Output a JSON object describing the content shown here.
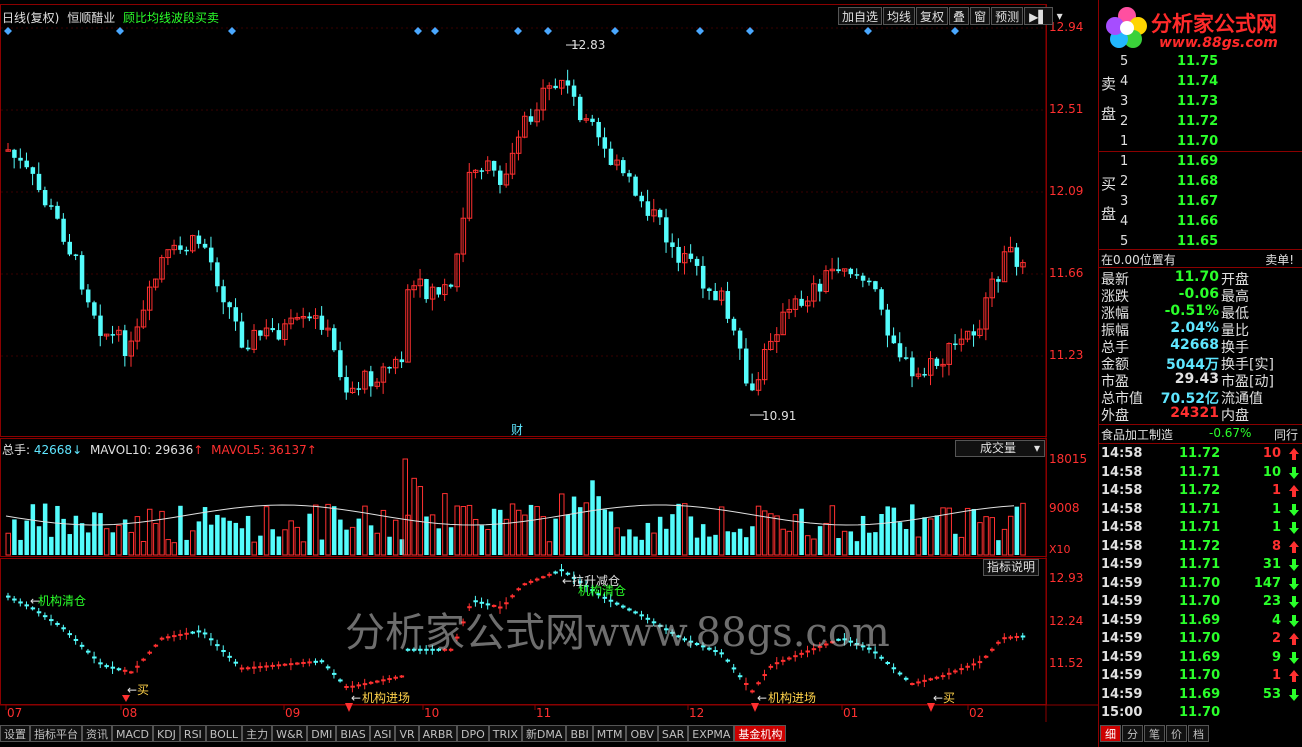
{
  "header": {
    "chart_title": "日线(复权)",
    "stock_name": "恒顺醋业",
    "indicator_name": "顾比均线波段买卖"
  },
  "toolbar": {
    "add_watch": "加自选",
    "ma": "均线",
    "restore": "复权",
    "overlay": "叠",
    "window": "窗",
    "forecast": "预测"
  },
  "price_axis": [
    "12.94",
    "12.51",
    "12.09",
    "11.66",
    "11.23"
  ],
  "price_labels": {
    "high": "12.83",
    "low": "10.91",
    "event": "财"
  },
  "volume_pane": {
    "label_total": "总手:",
    "total_value": "42668",
    "label_ma10": "MAVOL10:",
    "ma10_value": "29636",
    "label_ma5": "MAVOL5:",
    "ma5_value": "36137",
    "name": "成交量",
    "axis": [
      "18015",
      "9008"
    ],
    "unit": "X10"
  },
  "indicator_pane": {
    "help_button": "指标说明",
    "axis": [
      "12.93",
      "12.24",
      "11.52"
    ],
    "labels": {
      "clear1": "机构清仓",
      "buy1": "买",
      "enter1": "机构进场",
      "pull": "拉升减仓",
      "clear2": "机构清仓",
      "enter2": "机构进场",
      "buy2": "买"
    }
  },
  "date_axis": [
    "07",
    "08",
    "09",
    "10",
    "11",
    "12",
    "01",
    "02"
  ],
  "watermark": "分析家公式网www.88gs.com",
  "logo": {
    "name": "分析家公式网",
    "url": "www.88gs.com"
  },
  "orderbook": {
    "sell_label": [
      "卖",
      "盘"
    ],
    "buy_label": [
      "买",
      "盘"
    ],
    "sells": [
      {
        "level": "5",
        "price": "11.75"
      },
      {
        "level": "4",
        "price": "11.74"
      },
      {
        "level": "3",
        "price": "11.73"
      },
      {
        "level": "2",
        "price": "11.72"
      },
      {
        "level": "1",
        "price": "11.70"
      }
    ],
    "buys": [
      {
        "level": "1",
        "price": "11.69"
      },
      {
        "level": "2",
        "price": "11.68"
      },
      {
        "level": "3",
        "price": "11.67"
      },
      {
        "level": "4",
        "price": "11.66"
      },
      {
        "level": "5",
        "price": "11.65"
      }
    ]
  },
  "position": {
    "left": "在0.00位置有",
    "right": "卖单!"
  },
  "stats": [
    {
      "k1": "最新",
      "v1": "11.70",
      "c": "#2aff2a",
      "k2": "开盘"
    },
    {
      "k1": "涨跌",
      "v1": "-0.06",
      "c": "#2aff2a",
      "k2": "最高"
    },
    {
      "k1": "涨幅",
      "v1": "-0.51%",
      "c": "#2aff2a",
      "k2": "最低"
    },
    {
      "k1": "振幅",
      "v1": "2.04%",
      "c": "#5fe6ff",
      "k2": "量比"
    },
    {
      "k1": "总手",
      "v1": "42668",
      "c": "#5fe6ff",
      "k2": "换手"
    },
    {
      "k1": "金额",
      "v1": "5044万",
      "c": "#5fe6ff",
      "k2": "换手[实]"
    },
    {
      "k1": "市盈",
      "v1": "29.43",
      "c": "#e0e0e0",
      "k2": "市盈[动]"
    },
    {
      "k1": "总市值",
      "v1": "70.52亿",
      "c": "#5fe6ff",
      "k2": "流通值"
    },
    {
      "k1": "外盘",
      "v1": "24321",
      "c": "#ff3030",
      "k2": "内盘"
    }
  ],
  "sector": {
    "name": "食品加工制造",
    "change": "-0.67%",
    "peer": "同行"
  },
  "ticks": [
    {
      "t": "14:58",
      "p": "11.72",
      "v": "10",
      "dir": "up"
    },
    {
      "t": "14:58",
      "p": "11.71",
      "v": "10",
      "dir": "down"
    },
    {
      "t": "14:58",
      "p": "11.72",
      "v": "1",
      "dir": "up"
    },
    {
      "t": "14:58",
      "p": "11.71",
      "v": "1",
      "dir": "down"
    },
    {
      "t": "14:58",
      "p": "11.71",
      "v": "1",
      "dir": "down"
    },
    {
      "t": "14:58",
      "p": "11.72",
      "v": "8",
      "dir": "up"
    },
    {
      "t": "14:59",
      "p": "11.71",
      "v": "31",
      "dir": "down"
    },
    {
      "t": "14:59",
      "p": "11.70",
      "v": "147",
      "dir": "down"
    },
    {
      "t": "14:59",
      "p": "11.70",
      "v": "23",
      "dir": "down"
    },
    {
      "t": "14:59",
      "p": "11.69",
      "v": "4",
      "dir": "down"
    },
    {
      "t": "14:59",
      "p": "11.70",
      "v": "2",
      "dir": "up"
    },
    {
      "t": "14:59",
      "p": "11.69",
      "v": "9",
      "dir": "down"
    },
    {
      "t": "14:59",
      "p": "11.70",
      "v": "1",
      "dir": "up"
    },
    {
      "t": "14:59",
      "p": "11.69",
      "v": "53",
      "dir": "down"
    },
    {
      "t": "15:00",
      "p": "11.70",
      "v": "",
      "dir": "none"
    }
  ],
  "bottom_tabs": [
    "设置",
    "指标平台",
    "资讯",
    "MACD",
    "KDJ",
    "RSI",
    "BOLL",
    "主力",
    "W&R",
    "DMI",
    "BIAS",
    "ASI",
    "VR",
    "ARBR",
    "DPO",
    "TRIX",
    "新DMA",
    "BBI",
    "MTM",
    "OBV",
    "SAR",
    "EXPMA",
    "基金机构"
  ],
  "right_tabs": [
    "细",
    "分",
    "笔",
    "价",
    "档"
  ],
  "colors": {
    "up": "#ff3030",
    "down": "#54fcfc",
    "frame": "#8b0000",
    "green": "#2aff2a"
  }
}
